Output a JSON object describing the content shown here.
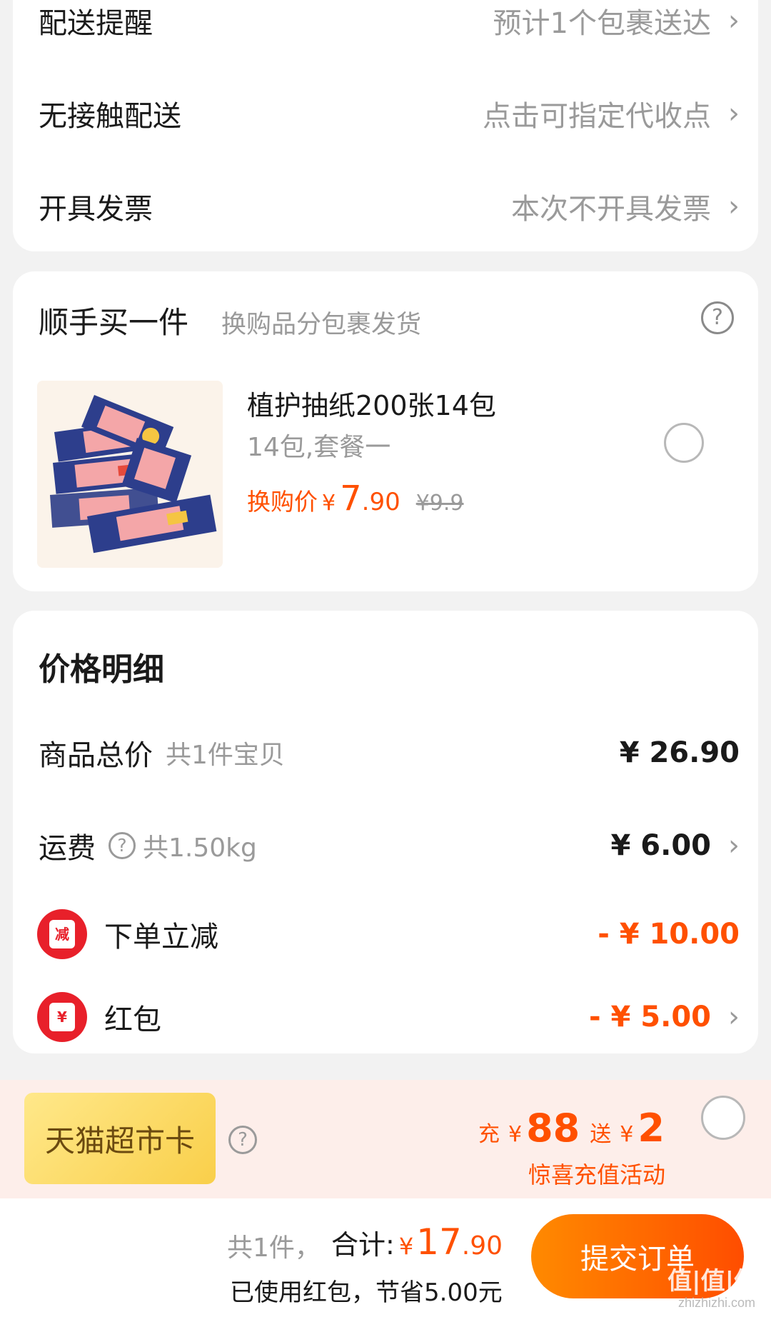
{
  "delivery": {
    "rows": [
      {
        "label": "配送提醒",
        "value": "预计1个包裹送达"
      },
      {
        "label": "无接触配送",
        "value": "点击可指定代收点"
      },
      {
        "label": "开具发票",
        "value": "本次不开具发票"
      }
    ]
  },
  "addon": {
    "title": "顺手买一件",
    "subtitle": "换购品分包裹发货",
    "help_icon": "?",
    "product": {
      "name": "植护抽纸200张14包",
      "spec": "14包,套餐一",
      "price_label": "换购价",
      "currency": "¥",
      "price_int": "7",
      "price_dec": ".90",
      "original_price": "¥9.9",
      "selected": false
    }
  },
  "price_detail": {
    "title": "价格明细",
    "items_total": {
      "label": "商品总价",
      "sub": "共1件宝贝",
      "amount": "¥ 26.90"
    },
    "shipping": {
      "label": "运费",
      "help_icon": "?",
      "sub": "共1.50kg",
      "amount": "¥ 6.00"
    },
    "discount": {
      "badge": "减",
      "label": "下单立减",
      "amount": "- ¥ 10.00"
    },
    "red_packet": {
      "badge": "¥",
      "label": "红包",
      "amount": "- ¥ 5.00"
    }
  },
  "tmall_card": {
    "name": "天猫超市卡",
    "help_icon": "?",
    "charge_label": "充",
    "charge_currency": "¥",
    "charge_amount": "88",
    "gift_label": "送",
    "gift_currency": "¥",
    "gift_amount": "2",
    "promo": "惊喜充值活动",
    "selected": false
  },
  "footer": {
    "count": "共1件，",
    "total_label": "合计:",
    "total_currency": "¥",
    "total_int": "17",
    "total_dec": ".90",
    "saved_text": "已使用红包，节省5.00元",
    "submit_label": "提交订单",
    "watermark": "值|值|值",
    "watermark_url": "zhizhizhi.com"
  },
  "colors": {
    "accent": "#ff5000",
    "badge_red": "#e8202a",
    "muted": "#9a9a9a"
  }
}
